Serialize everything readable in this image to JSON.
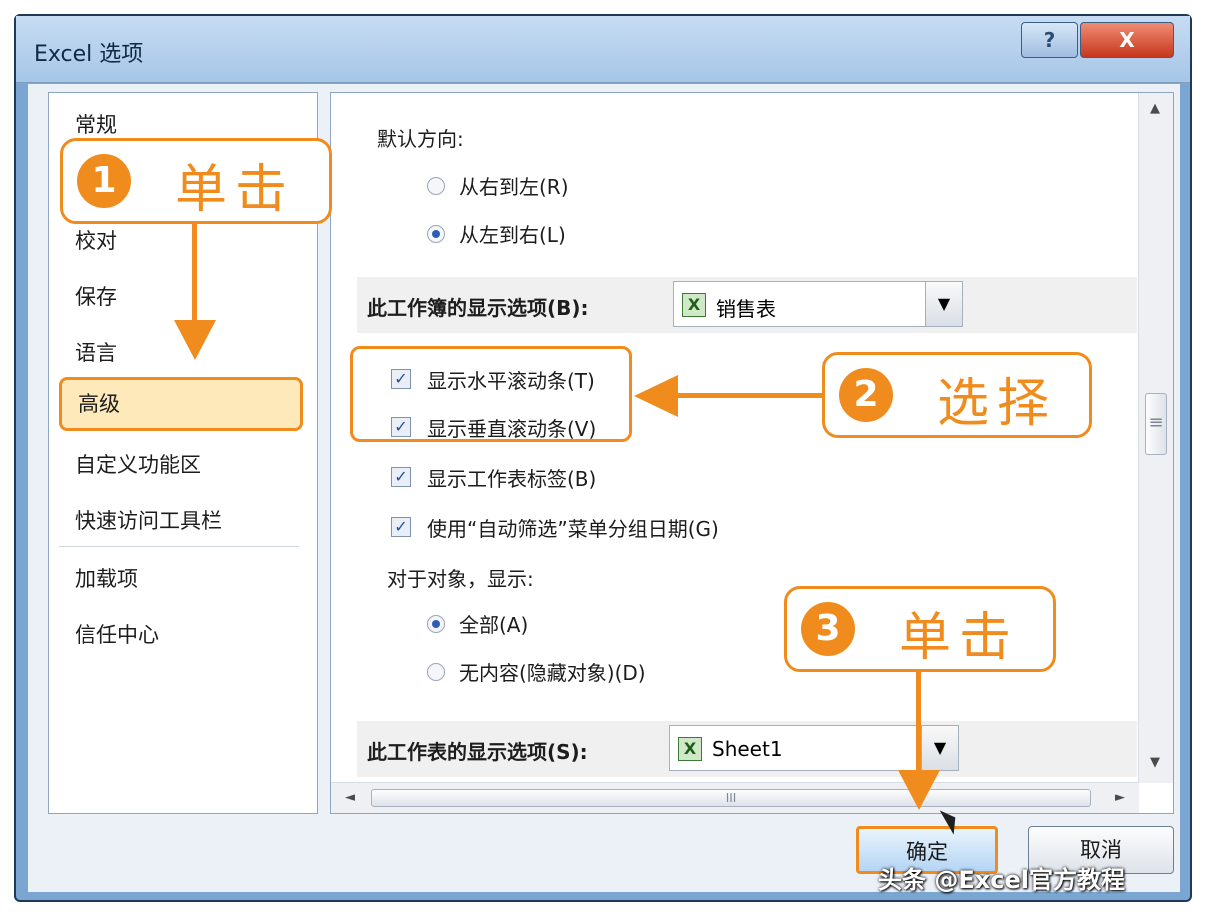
{
  "window": {
    "title": "Excel 选项",
    "help_label": "?",
    "close_label": "X"
  },
  "nav": {
    "items": [
      {
        "label": "常规"
      },
      {
        "label": "校对"
      },
      {
        "label": "保存"
      },
      {
        "label": "语言"
      },
      {
        "label": "高级"
      },
      {
        "label": "自定义功能区"
      },
      {
        "label": "快速访问工具栏"
      },
      {
        "label": "加载项"
      },
      {
        "label": "信任中心"
      }
    ]
  },
  "content": {
    "direction_heading": "默认方向:",
    "dir_rtl": "从右到左(R)",
    "dir_ltr": "从左到右(L)",
    "workbook_section_label": "此工作簿的显示选项(B):",
    "workbook_select_value": "销售表",
    "chk_hscroll": "显示水平滚动条(T)",
    "chk_vscroll": "显示垂直滚动条(V)",
    "chk_sheet_tabs": "显示工作表标签(B)",
    "chk_autofilter": "使用“自动筛选”菜单分组日期(G)",
    "objects_heading": "对于对象，显示:",
    "obj_all": "全部(A)",
    "obj_none": "无内容(隐藏对象)(D)",
    "sheet_section_label": "此工作表的显示选项(S):",
    "sheet_select_value": "Sheet1"
  },
  "buttons": {
    "ok": "确定",
    "cancel": "取消"
  },
  "callouts": [
    {
      "num": "1",
      "word": "单击"
    },
    {
      "num": "2",
      "word": "选择"
    },
    {
      "num": "3",
      "word": "单击"
    }
  ],
  "watermark": "头条 @Excel官方教程",
  "colors": {
    "accent": "#f08c1d",
    "title_bar": "#a6c6e8"
  }
}
